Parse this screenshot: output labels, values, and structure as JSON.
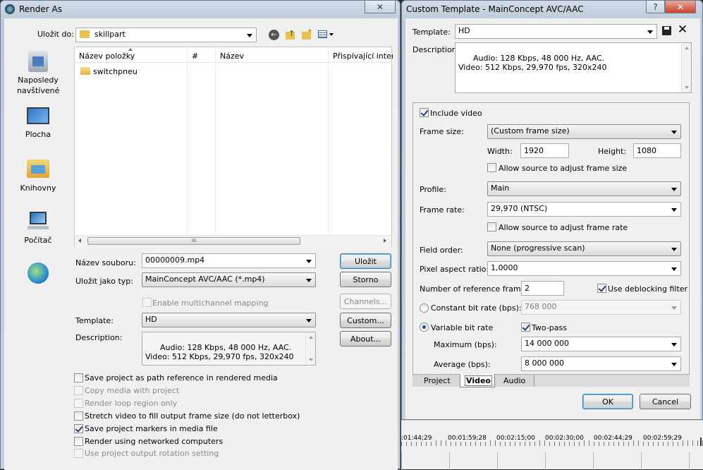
{
  "render_as": {
    "title": "Render As",
    "close_glyph": "✕",
    "save_in_label": "Uložit do:",
    "save_in_value": "skillpart",
    "places": [
      {
        "label": "Naposledy navštívené",
        "icon": "recent-places-icon"
      },
      {
        "label": "Plocha",
        "icon": "desktop-icon"
      },
      {
        "label": "Knihovny",
        "icon": "libraries-icon"
      },
      {
        "label": "Počítač",
        "icon": "computer-icon"
      },
      {
        "label": "",
        "icon": "network-icon"
      }
    ],
    "columns": [
      "Název položky",
      "#",
      "Název",
      "Přispívající interp"
    ],
    "files": [
      {
        "name": "switchpneu",
        "icon": "folder-icon"
      }
    ],
    "filename_label": "Název souboru:",
    "filename_value": "00000009.mp4",
    "savetype_label": "Uložit jako typ:",
    "savetype_value": "MainConcept AVC/AAC (*.mp4)",
    "multichannel_label": "Enable multichannel mapping",
    "template_label": "Template:",
    "template_value": "HD",
    "description_label": "Description:",
    "description_text": "Audio: 128 Kbps, 48 000 Hz, AAC.\nVideo: 512 Kbps, 29,970 fps, 320x240",
    "buttons": {
      "save": "Uložit",
      "cancel": "Storno",
      "channels": "Channels...",
      "custom": "Custom...",
      "about": "About..."
    },
    "options": [
      {
        "label": "Save project as path reference in rendered media",
        "checked": false,
        "enabled": true
      },
      {
        "label": "Copy media with project",
        "checked": false,
        "enabled": false
      },
      {
        "label": "Render loop region only",
        "checked": false,
        "enabled": false
      },
      {
        "label": "Stretch video to fill output frame size (do not letterbox)",
        "checked": false,
        "enabled": true
      },
      {
        "label": "Save project markers in media file",
        "checked": true,
        "enabled": true
      },
      {
        "label": "Render using networked computers",
        "checked": false,
        "enabled": true
      },
      {
        "label": "Use project output rotation setting",
        "checked": false,
        "enabled": false
      }
    ],
    "hscroll_grip": "III"
  },
  "custom_template": {
    "title": "Custom Template - MainConcept AVC/AAC",
    "help_glyph": "?",
    "close_glyph": "✕",
    "template_label": "Template:",
    "template_value": "HD",
    "description_label": "Description:",
    "description_text": "Audio: 128 Kbps, 48 000 Hz, AAC.\nVideo: 512 Kbps, 29,970 fps, 320x240",
    "include_video_label": "Include video",
    "frame_size_label": "Frame size:",
    "frame_size_value": "(Custom frame size)",
    "width_label": "Width:",
    "width_value": "1920",
    "height_label": "Height:",
    "height_value": "1080",
    "allow_frame_size_label": "Allow source to adjust frame size",
    "profile_label": "Profile:",
    "profile_value": "Main",
    "frame_rate_label": "Frame rate:",
    "frame_rate_value": "29,970 (NTSC)",
    "allow_frame_rate_label": "Allow source to adjust frame rate",
    "field_order_label": "Field order:",
    "field_order_value": "None (progressive scan)",
    "par_label": "Pixel aspect ratio:",
    "par_value": "1,0000",
    "ref_frames_label": "Number of reference frames:",
    "ref_frames_value": "2",
    "deblocking_label": "Use deblocking filter",
    "cbr_label": "Constant bit rate (bps):",
    "cbr_value": "768 000",
    "vbr_label": "Variable bit rate",
    "two_pass_label": "Two-pass",
    "max_label": "Maximum (bps):",
    "max_value": "14 000 000",
    "avg_label": "Average (bps):",
    "avg_value": "8 000 000",
    "tabs": [
      "Project",
      "Video",
      "Audio"
    ],
    "active_tab": "Video",
    "ok": "OK",
    "cancel": "Cancel"
  },
  "timeline": {
    "timecodes": [
      ":01:44;29",
      "00:01:59;28",
      "00:02:15;00",
      "00:02:30;00",
      "00:02:44;29",
      "00:02:59;29"
    ]
  }
}
